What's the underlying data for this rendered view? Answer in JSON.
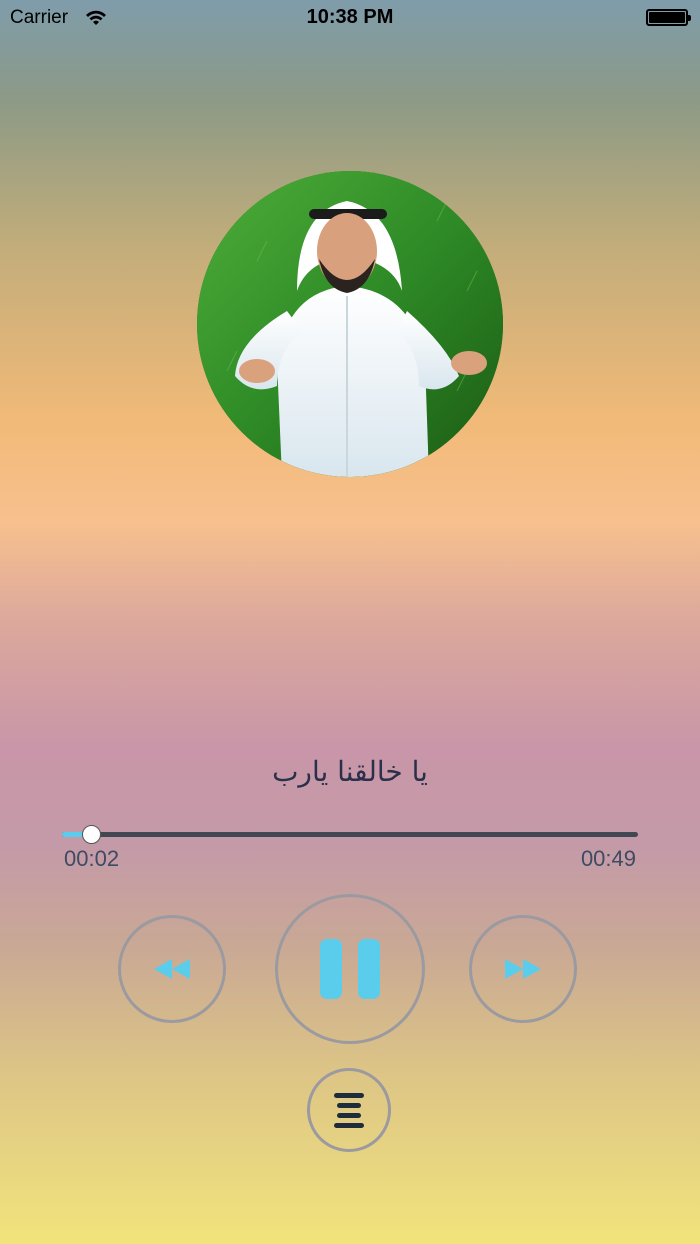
{
  "status_bar": {
    "carrier": "Carrier",
    "time": "10:38 PM"
  },
  "player": {
    "track_title": "يا خالقنا يارب",
    "elapsed": "00:02",
    "duration": "00:49",
    "progress": 0.05,
    "accent_color": "#59cdeb"
  },
  "controls": {
    "rewind_icon": "rewind-icon",
    "pause_icon": "pause-icon",
    "forward_icon": "fast-forward-icon",
    "menu_icon": "menu-icon"
  }
}
